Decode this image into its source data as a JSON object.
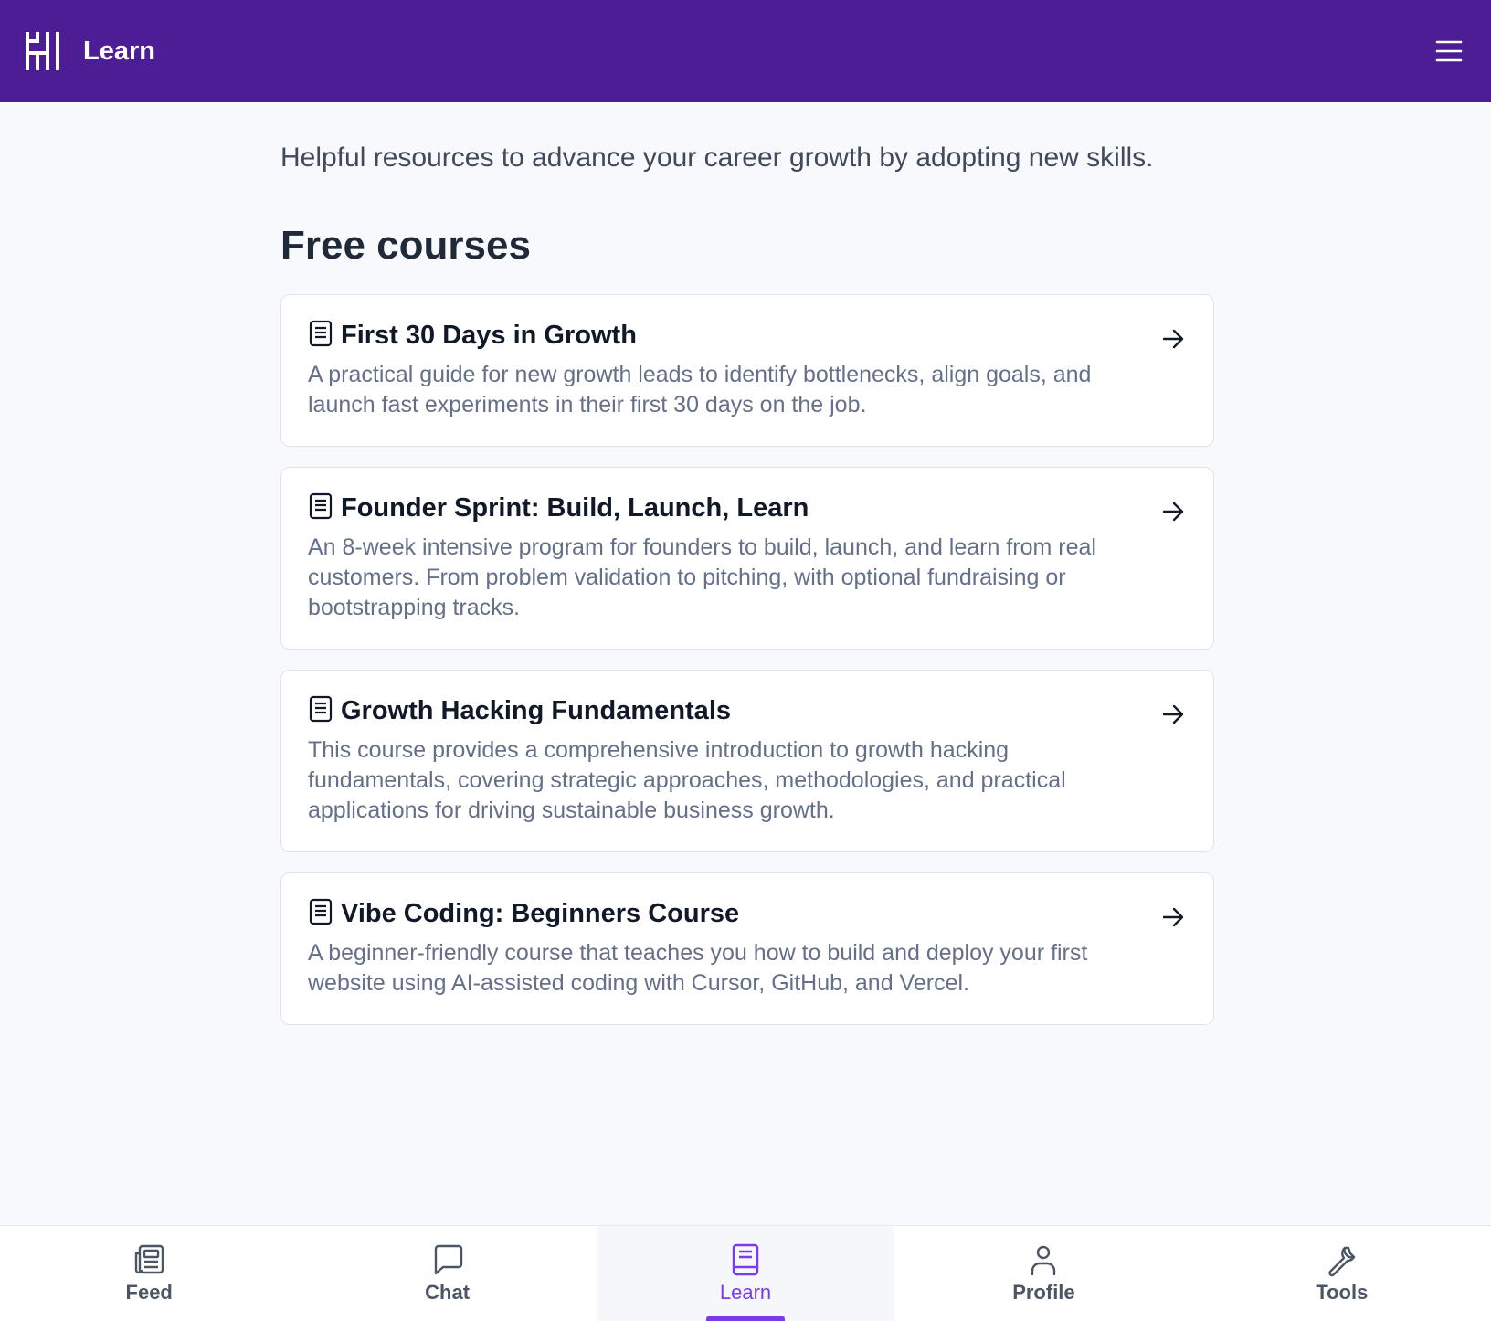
{
  "header": {
    "title": "Learn",
    "logo_icon": "brand-logo",
    "menu_icon": "hamburger-menu-icon",
    "background": "#4c1d95"
  },
  "intro": "Helpful resources to advance your career growth by adopting new skills.",
  "section_title": "Free courses",
  "courses": [
    {
      "title": "First 30 Days in Growth",
      "description": "A practical guide for new growth leads to identify bottlenecks, align goals, and launch fast experiments in their first 30 days on the job."
    },
    {
      "title": "Founder Sprint: Build, Launch, Learn",
      "description": "An 8-week intensive program for founders to build, launch, and learn from real customers. From problem validation to pitching, with optional fundraising or bootstrapping tracks."
    },
    {
      "title": "Growth Hacking Fundamentals",
      "description": "This course provides a comprehensive introduction to growth hacking fundamentals, covering strategic approaches, methodologies, and practical applications for driving sustainable business growth."
    },
    {
      "title": "Vibe Coding: Beginners Course",
      "description": "A beginner-friendly course that teaches you how to build and deploy your first website using AI-assisted coding with Cursor, GitHub, and Vercel."
    }
  ],
  "nav": [
    {
      "label": "Feed",
      "icon": "newspaper-icon",
      "active": false
    },
    {
      "label": "Chat",
      "icon": "chat-bubble-icon",
      "active": false
    },
    {
      "label": "Learn",
      "icon": "book-icon",
      "active": true
    },
    {
      "label": "Profile",
      "icon": "user-icon",
      "active": false
    },
    {
      "label": "Tools",
      "icon": "wrench-icon",
      "active": false
    }
  ],
  "colors": {
    "accent": "#7c3aed",
    "header_bg": "#4c1d95",
    "page_bg": "#f8f9fc"
  }
}
